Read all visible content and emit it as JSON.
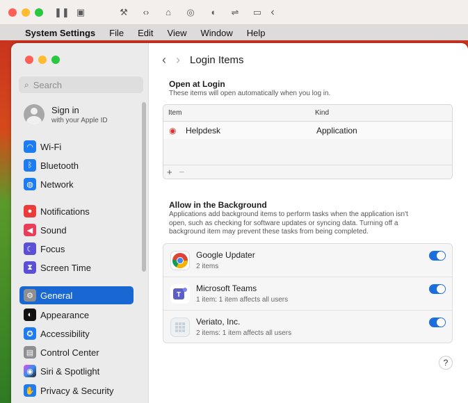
{
  "menubar": {
    "app": "System Settings",
    "items": [
      "File",
      "Edit",
      "View",
      "Window",
      "Help"
    ]
  },
  "colors": {
    "accent": "#1967d2",
    "toggle_on": "#1a6fdc"
  },
  "sidebar": {
    "search_placeholder": "Search",
    "apple_id": {
      "title": "Sign in",
      "subtitle": "with your Apple ID"
    },
    "items": [
      {
        "label": "Wi-Fi",
        "icon": "wifi-icon",
        "color": "#1e7cf2"
      },
      {
        "label": "Bluetooth",
        "icon": "bluetooth-icon",
        "color": "#1e7cf2"
      },
      {
        "label": "Network",
        "icon": "globe-icon",
        "color": "#1e7cf2"
      },
      {
        "label": "Notifications",
        "icon": "bell-icon",
        "color": "#ea3d3a"
      },
      {
        "label": "Sound",
        "icon": "speaker-icon",
        "color": "#ea3d5a"
      },
      {
        "label": "Focus",
        "icon": "moon-icon",
        "color": "#5b4fd6"
      },
      {
        "label": "Screen Time",
        "icon": "hourglass-icon",
        "color": "#5b4fd6"
      },
      {
        "label": "General",
        "icon": "gear-icon",
        "color": "#8e8e93"
      },
      {
        "label": "Appearance",
        "icon": "appearance-icon",
        "color": "#111111"
      },
      {
        "label": "Accessibility",
        "icon": "accessibility-icon",
        "color": "#1e7cf2"
      },
      {
        "label": "Control Center",
        "icon": "control-center-icon",
        "color": "#8e8e93"
      },
      {
        "label": "Siri & Spotlight",
        "icon": "siri-icon",
        "color": "#222222"
      },
      {
        "label": "Privacy & Security",
        "icon": "hand-icon",
        "color": "#1e7cf2"
      }
    ]
  },
  "main": {
    "title": "Login Items",
    "open_at_login": {
      "title": "Open at Login",
      "description": "These items will open automatically when you log in.",
      "columns": [
        "Item",
        "Kind"
      ],
      "rows": [
        {
          "item": "Helpdesk",
          "kind": "Application"
        }
      ],
      "add": "+",
      "remove": "−"
    },
    "background": {
      "title": "Allow in the Background",
      "description_lines": [
        "Applications add background items to perform tasks when the application isn't",
        "open, such as checking for software updates or syncing data. Turning off a",
        "background item may prevent these tasks from being completed."
      ],
      "items": [
        {
          "name": "Google Updater",
          "detail": "2 items",
          "enabled": true
        },
        {
          "name": "Microsoft Teams",
          "detail": "1 item: 1 item affects all users",
          "enabled": true
        },
        {
          "name": "Veriato, Inc.",
          "detail": "2 items: 1 item affects all users",
          "enabled": true
        }
      ]
    },
    "help": "?"
  }
}
